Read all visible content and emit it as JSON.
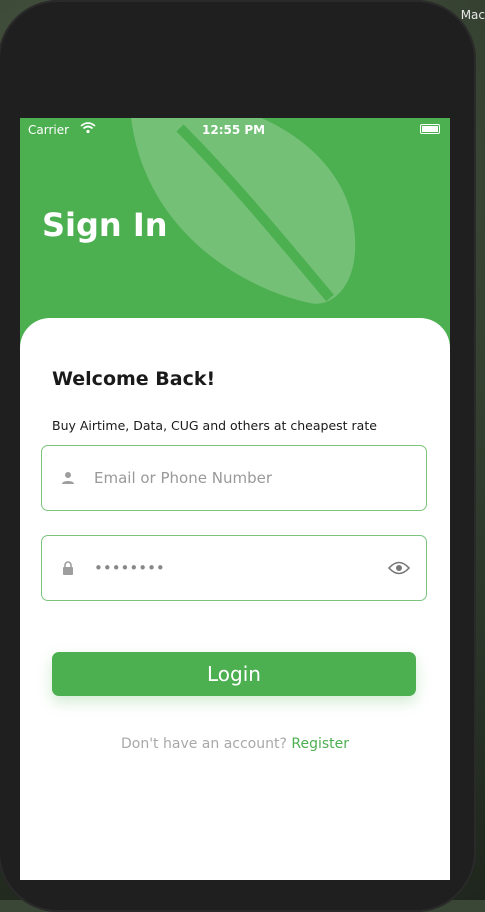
{
  "desktop": {
    "label": "Mac"
  },
  "status_bar": {
    "carrier": "Carrier",
    "time": "12:55 PM"
  },
  "header": {
    "title": "Sign In"
  },
  "card": {
    "welcome": "Welcome Back!",
    "subtitle": "Buy Airtime, Data, CUG and others at cheapest rate"
  },
  "form": {
    "email_placeholder": "Email or Phone Number",
    "email_value": "",
    "password_value": "••••••••"
  },
  "login_button": {
    "label": "Login"
  },
  "register": {
    "prompt": "Don't have an account?",
    "link": "Register"
  },
  "icons": {
    "wifi": "wifi-icon",
    "battery": "battery-icon",
    "user": "user-icon",
    "lock": "lock-icon",
    "eye": "eye-icon",
    "leaf": "leaf-icon"
  },
  "colors": {
    "brand": "#4caf50",
    "border": "#7cc47e",
    "text": "#1a1a1a",
    "muted": "#a8a8a8"
  }
}
